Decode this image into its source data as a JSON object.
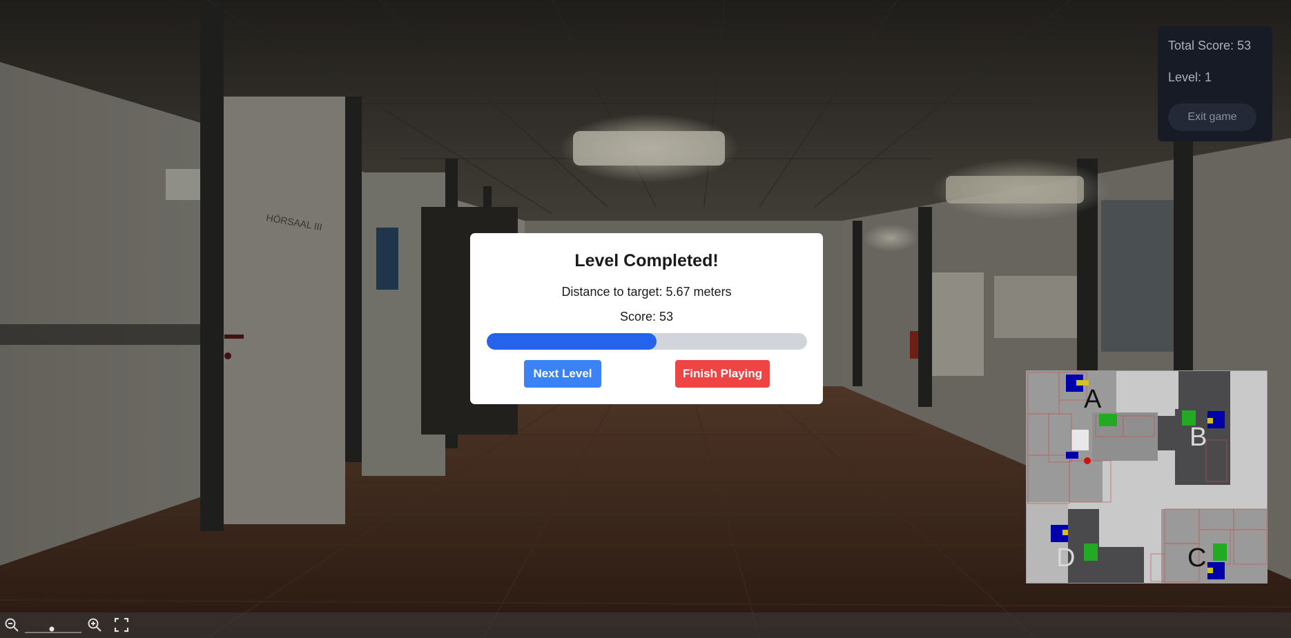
{
  "hud": {
    "total_score": "Total Score: 53",
    "level": "Level: 1",
    "exit_label": "Exit game"
  },
  "modal": {
    "title": "Level Completed!",
    "distance": "Distance to target: 5.67 meters",
    "score": "Score: 53",
    "progress_fraction": 0.53,
    "next_label": "Next Level",
    "finish_label": "Finish Playing"
  },
  "minimap": {
    "labels": [
      "A",
      "B",
      "C",
      "D"
    ]
  },
  "scene": {
    "sign_text": "HÖRSAAL III"
  },
  "colors": {
    "hud_bg": "#161b26",
    "progress_fill": "#2563eb",
    "next_button": "#3b82f6",
    "finish_button": "#ef4444"
  },
  "icons": [
    "zoom-out-icon",
    "zoom-in-icon",
    "fullscreen-icon"
  ]
}
